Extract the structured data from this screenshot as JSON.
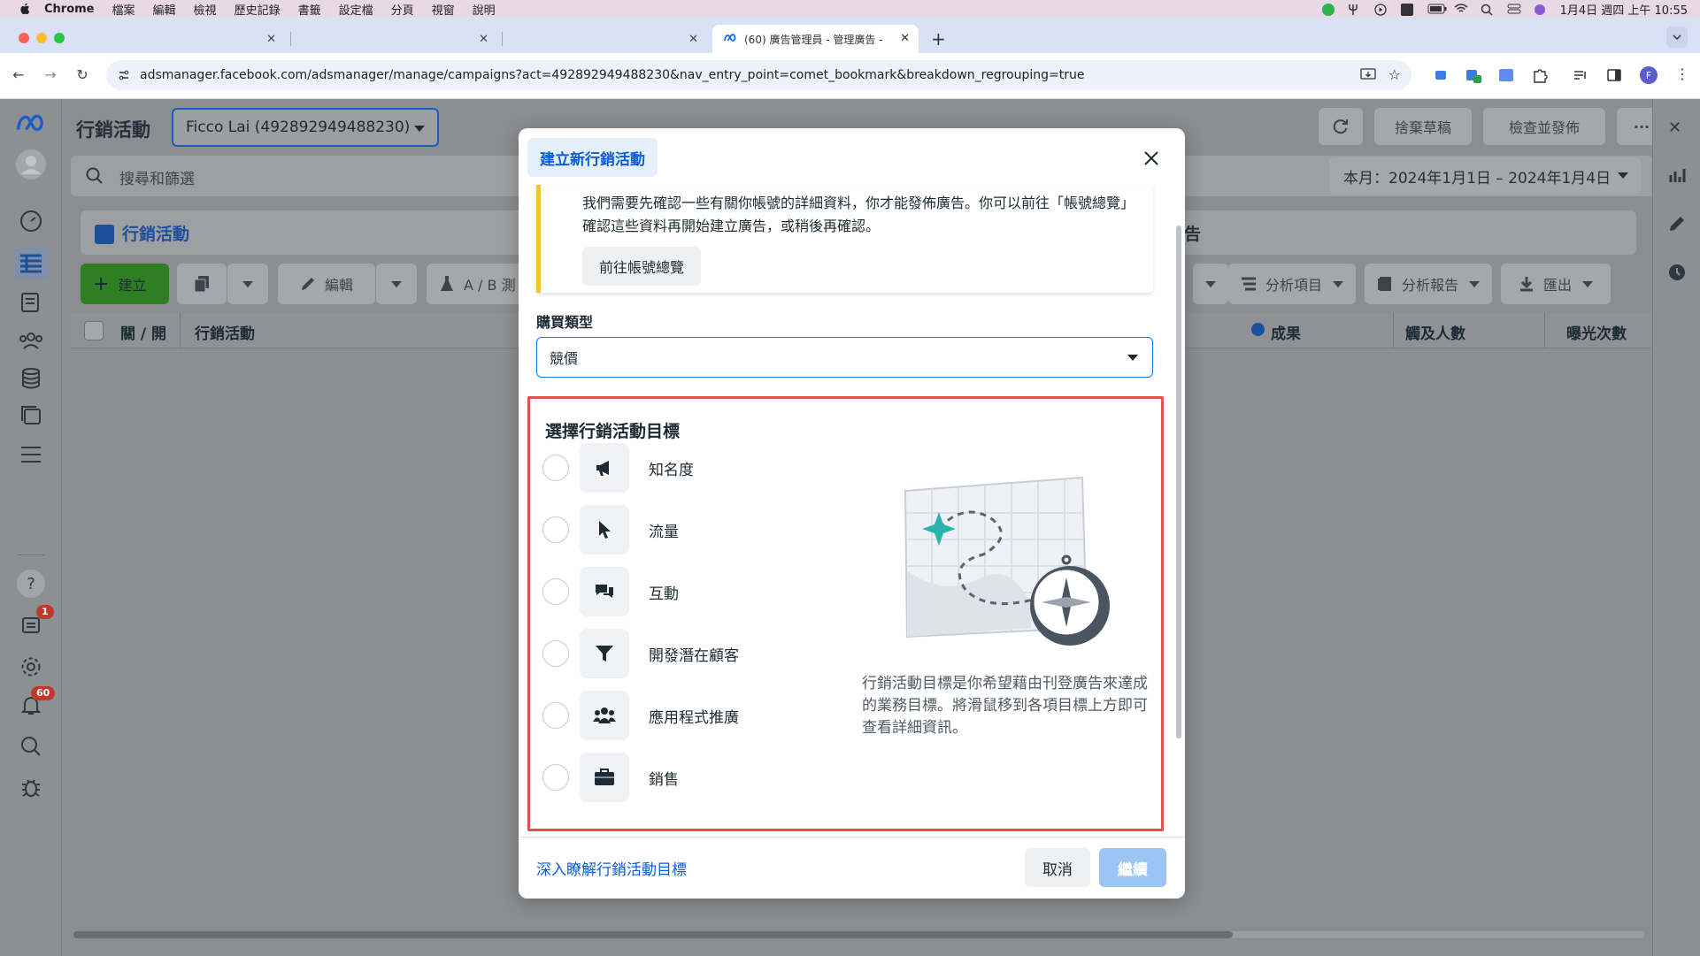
{
  "menubar": {
    "app": "Chrome",
    "menus": [
      "檔案",
      "編輯",
      "檢視",
      "歷史記錄",
      "書籤",
      "設定檔",
      "分頁",
      "視窗",
      "說明"
    ],
    "datetime": "1月4日 週四 上午 10:55"
  },
  "tabs": {
    "active_title": "(60) 廣告管理員 - 管理廣告 - ",
    "new_tab": "+"
  },
  "address": {
    "url": "adsmanager.facebook.com/adsmanager/manage/campaigns?act=492892949488230&nav_entry_point=comet_bookmark&breakdown_regrouping=true",
    "profile": "F"
  },
  "header": {
    "title": "行銷活動",
    "account": "Ficco Lai (492892949488230)",
    "discard": "捨棄草稿",
    "review": "檢查並發佈",
    "more": "···"
  },
  "search": {
    "placeholder": "搜尋和篩選",
    "date_range": "本月：2024年1月1日 – 2024年1月4日"
  },
  "tabsrow": {
    "campaigns": "行銷活動",
    "ads_partial": "告"
  },
  "actions": {
    "create": "建立",
    "edit": "編輯",
    "ab_test": "A / B 測",
    "breakdown": "分析項目",
    "reports": "分析報告",
    "export": "匯出"
  },
  "table": {
    "col_onoff": "關 / 開",
    "col_campaign": "行銷活動",
    "col_results": "成果",
    "col_reach": "觸及人數",
    "col_impressions": "曝光次數"
  },
  "leftnav": {
    "badge_ads": "1",
    "badge_notifications": "60",
    "help": "?"
  },
  "modal": {
    "title": "建立新行銷活動",
    "notice_text": "我們需要先確認一些有關你帳號的詳細資料，你才能發佈廣告。你可以前往「帳號總覽」確認這些資料再開始建立廣告，或稍後再確認。",
    "notice_button": "前往帳號總覽",
    "buy_type_label": "購買類型",
    "buy_type_value": "競價",
    "objective_title": "選擇行銷活動目標",
    "objectives": [
      {
        "label": "知名度",
        "icon": "megaphone-icon"
      },
      {
        "label": "流量",
        "icon": "cursor-icon"
      },
      {
        "label": "互動",
        "icon": "chat-icon"
      },
      {
        "label": "開發潛在顧客",
        "icon": "filter-icon"
      },
      {
        "label": "應用程式推廣",
        "icon": "people-icon"
      },
      {
        "label": "銷售",
        "icon": "briefcase-icon"
      }
    ],
    "objective_description": "行銷活動目標是你希望藉由刊登廣告來達成的業務目標。將滑鼠移到各項目標上方即可查看詳細資訊。",
    "learn_link": "深入瞭解行銷活動目標",
    "cancel": "取消",
    "continue": "繼續"
  },
  "colors": {
    "accent": "#0a78f2",
    "link": "#0a5cd8",
    "create_green": "#42b72a",
    "highlight_red": "#e05252",
    "warning_yellow": "#f5c33b"
  }
}
